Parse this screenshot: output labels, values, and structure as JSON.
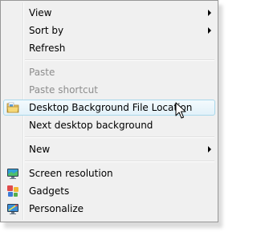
{
  "context_menu": {
    "items": [
      {
        "label": "View",
        "state": "normal",
        "submenu": true
      },
      {
        "label": "Sort by",
        "state": "normal",
        "submenu": true
      },
      {
        "label": "Refresh",
        "state": "normal",
        "submenu": false
      },
      {
        "label": "Paste",
        "state": "disabled",
        "submenu": false
      },
      {
        "label": "Paste shortcut",
        "state": "disabled",
        "submenu": false
      },
      {
        "label": "Desktop Background File Location",
        "state": "highlighted",
        "submenu": false,
        "icon": "folder-icon"
      },
      {
        "label": "Next desktop background",
        "state": "normal",
        "submenu": false
      },
      {
        "label": "New",
        "state": "normal",
        "submenu": true
      },
      {
        "label": "Screen resolution",
        "state": "normal",
        "submenu": false,
        "icon": "monitor-icon"
      },
      {
        "label": "Gadgets",
        "state": "normal",
        "submenu": false,
        "icon": "gadgets-icon"
      },
      {
        "label": "Personalize",
        "state": "normal",
        "submenu": false,
        "icon": "personalize-icon"
      }
    ]
  },
  "colors": {
    "menu_background": "#f0f0f0",
    "menu_border": "#979797",
    "highlight_border": "#a8d8eb",
    "disabled_text": "#8d8d8d"
  }
}
